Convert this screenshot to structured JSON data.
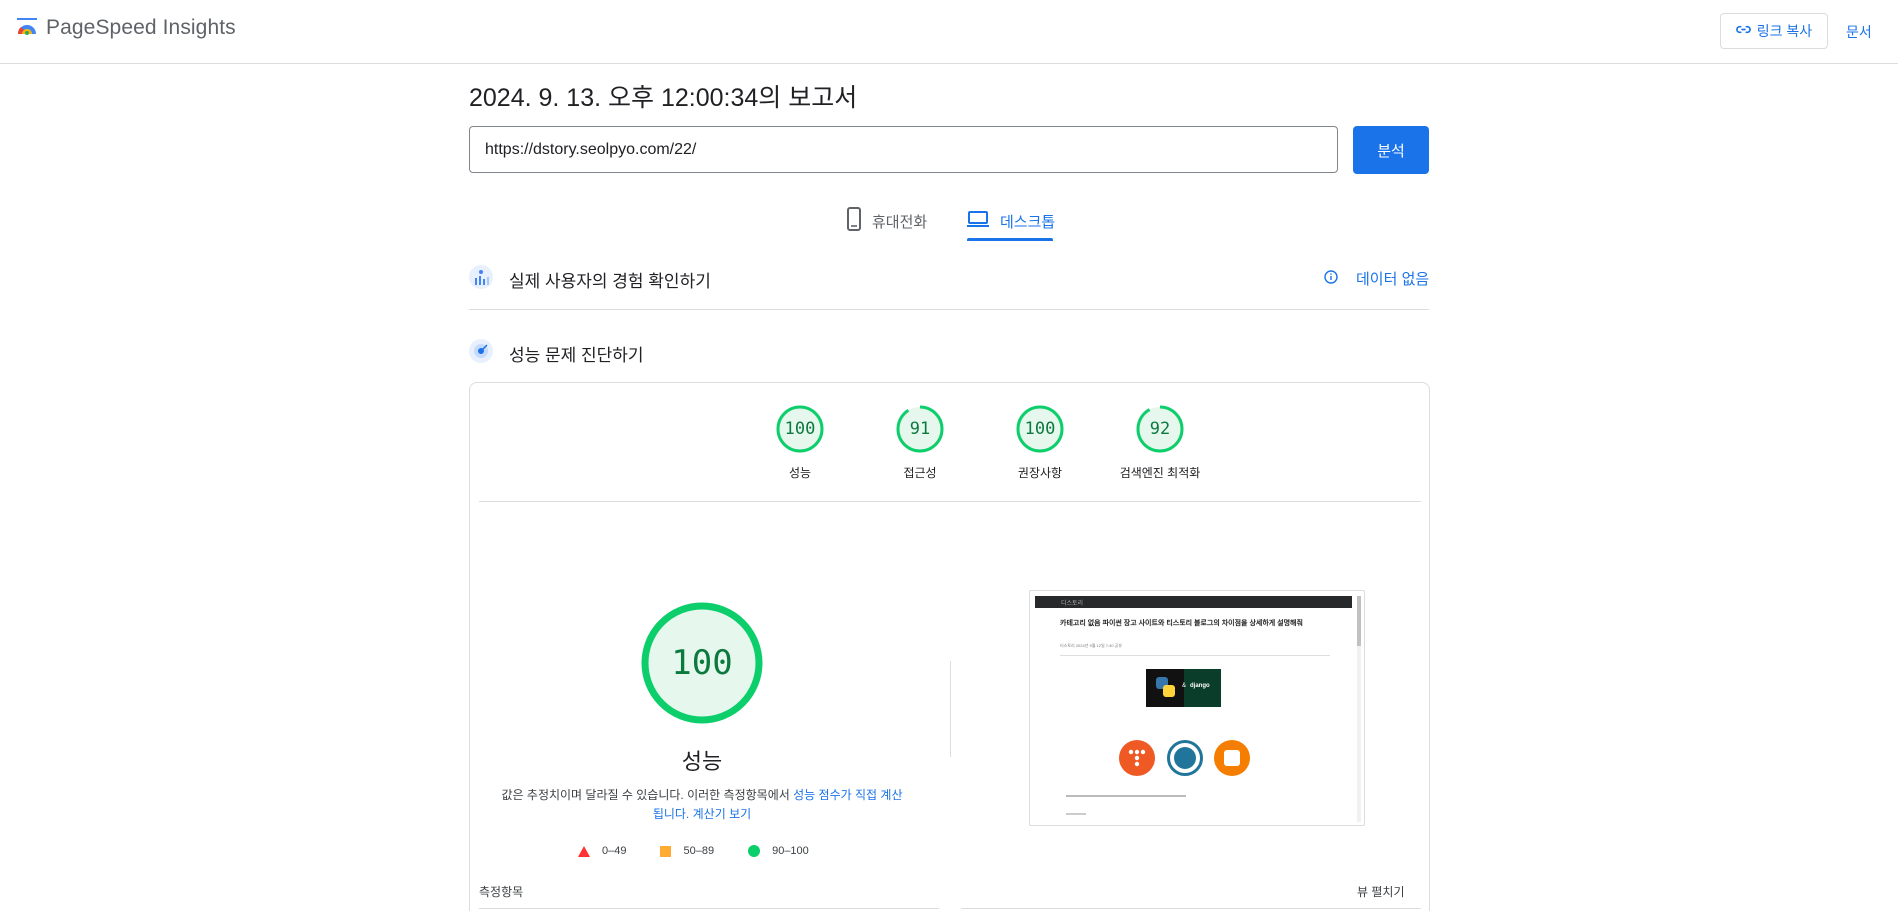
{
  "header": {
    "app_title": "PageSpeed Insights",
    "copy_link_label": "링크 복사",
    "docs_label": "문서"
  },
  "report": {
    "title": "2024. 9. 13. 오후 12:00:34의 보고서",
    "url_value": "https://dstory.seolpyo.com/22/",
    "analyze_label": "분석"
  },
  "tabs": [
    {
      "label": "휴대전화",
      "icon": "mobile-icon",
      "selected": false
    },
    {
      "label": "데스크톱",
      "icon": "laptop-icon",
      "selected": true
    }
  ],
  "crux": {
    "label": "실제 사용자의 경험 확인하기",
    "no_data_label": "데이터 없음"
  },
  "lab": {
    "label": "성능 문제 진단하기"
  },
  "categories": [
    {
      "score": "100",
      "label": "성능",
      "fraction": 1.0
    },
    {
      "score": "91",
      "label": "접근성",
      "fraction": 0.91
    },
    {
      "score": "100",
      "label": "권장사항",
      "fraction": 1.0
    },
    {
      "score": "92",
      "label": "검색엔진 최적화",
      "fraction": 0.92
    }
  ],
  "performance": {
    "score": "100",
    "label": "성능",
    "desc_prefix": "값은 추정치이며 달라질 수 있습니다. 이러한 측정항목에서 ",
    "desc_link1": "성능 점수가 직접 계산됩니다.",
    "desc_link2": "계산기 보기"
  },
  "legend": [
    {
      "range": "0–49",
      "shape": "triangle",
      "color": "#ff3333"
    },
    {
      "range": "50–89",
      "shape": "square",
      "color": "#ffaa33"
    },
    {
      "range": "90–100",
      "shape": "circle",
      "color": "#0cce6b"
    }
  ],
  "thumbnail": {
    "bar_text": "디스토리",
    "title": "카테고리 없음 파이썬 장고 사이트와 티스토리 블로그의 차이점을 상세하게 설명해줘",
    "meta": "티스토리 2024년 9월 12일 7:40 공유",
    "hero_text": "django",
    "hero_amp": "&"
  },
  "metrics": {
    "label": "측정항목",
    "expand_label": "뷰 펼치기"
  },
  "colors": {
    "accent": "#1a73e8",
    "pass": "#0cce6b",
    "pass_text": "#0c7a3f",
    "pass_fill": "#e6f8ee"
  }
}
